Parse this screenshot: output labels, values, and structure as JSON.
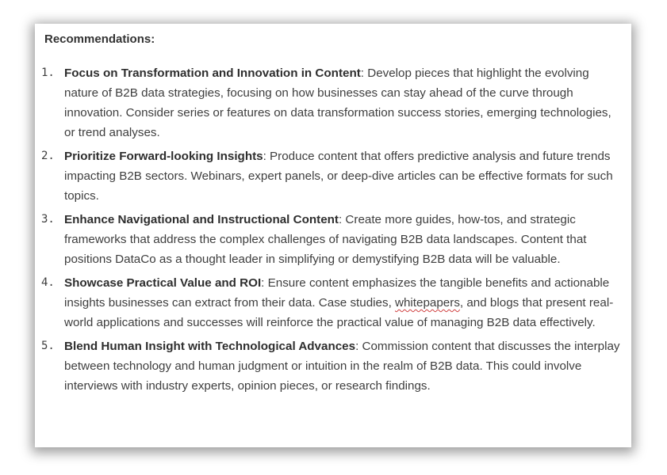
{
  "heading": "Recommendations:",
  "items": [
    {
      "number": "1.",
      "title": "Focus on Transformation and Innovation in Content",
      "body": ": Develop pieces that highlight the evolving nature of B2B data strategies, focusing on how businesses can stay ahead of the curve through innovation. Consider series or features on data transformation success stories, emerging technologies, or trend analyses."
    },
    {
      "number": "2.",
      "title": "Prioritize Forward-looking Insights",
      "body": ": Produce content that offers predictive analysis and future trends impacting B2B sectors. Webinars, expert panels, or deep-dive articles can be effective formats for such topics."
    },
    {
      "number": "3.",
      "title": "Enhance Navigational and Instructional Content",
      "body": ": Create more guides, how-tos, and strategic frameworks that address the complex challenges of navigating B2B data landscapes. Content that positions DataCo as a thought leader in simplifying or demystifying B2B data will be valuable."
    },
    {
      "number": "4.",
      "title": "Showcase Practical Value and ROI",
      "body_before": ": Ensure content emphasizes the tangible benefits and actionable insights businesses can extract from their data. Case studies, ",
      "body_flagged": "whitepapers",
      "body_after": ", and blogs that present real-world applications and successes will reinforce the practical value of managing B2B data effectively."
    },
    {
      "number": "5.",
      "title": "Blend Human Insight with Technological Advances",
      "body": ": Commission content that discusses the interplay between technology and human judgment or intuition in the realm of B2B data. This could involve interviews with industry experts, opinion pieces, or research findings."
    }
  ]
}
